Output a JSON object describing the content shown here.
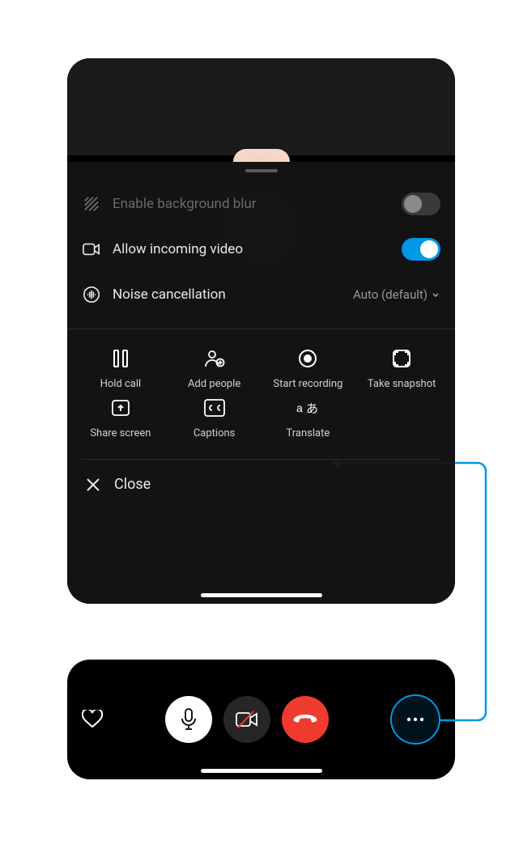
{
  "settings": {
    "blur": {
      "label": "Enable background blur",
      "enabled": false
    },
    "incoming_video": {
      "label": "Allow incoming video",
      "enabled": true
    },
    "noise_cancel": {
      "label": "Noise cancellation",
      "value": "Auto (default)"
    }
  },
  "actions": {
    "hold": "Hold call",
    "add_people": "Add people",
    "start_recording": "Start recording",
    "take_snapshot": "Take snapshot",
    "share_screen": "Share screen",
    "captions": "Captions",
    "translate": "Translate"
  },
  "close_label": "Close",
  "colors": {
    "accent": "#0098e6",
    "danger": "#ef3b2f"
  }
}
